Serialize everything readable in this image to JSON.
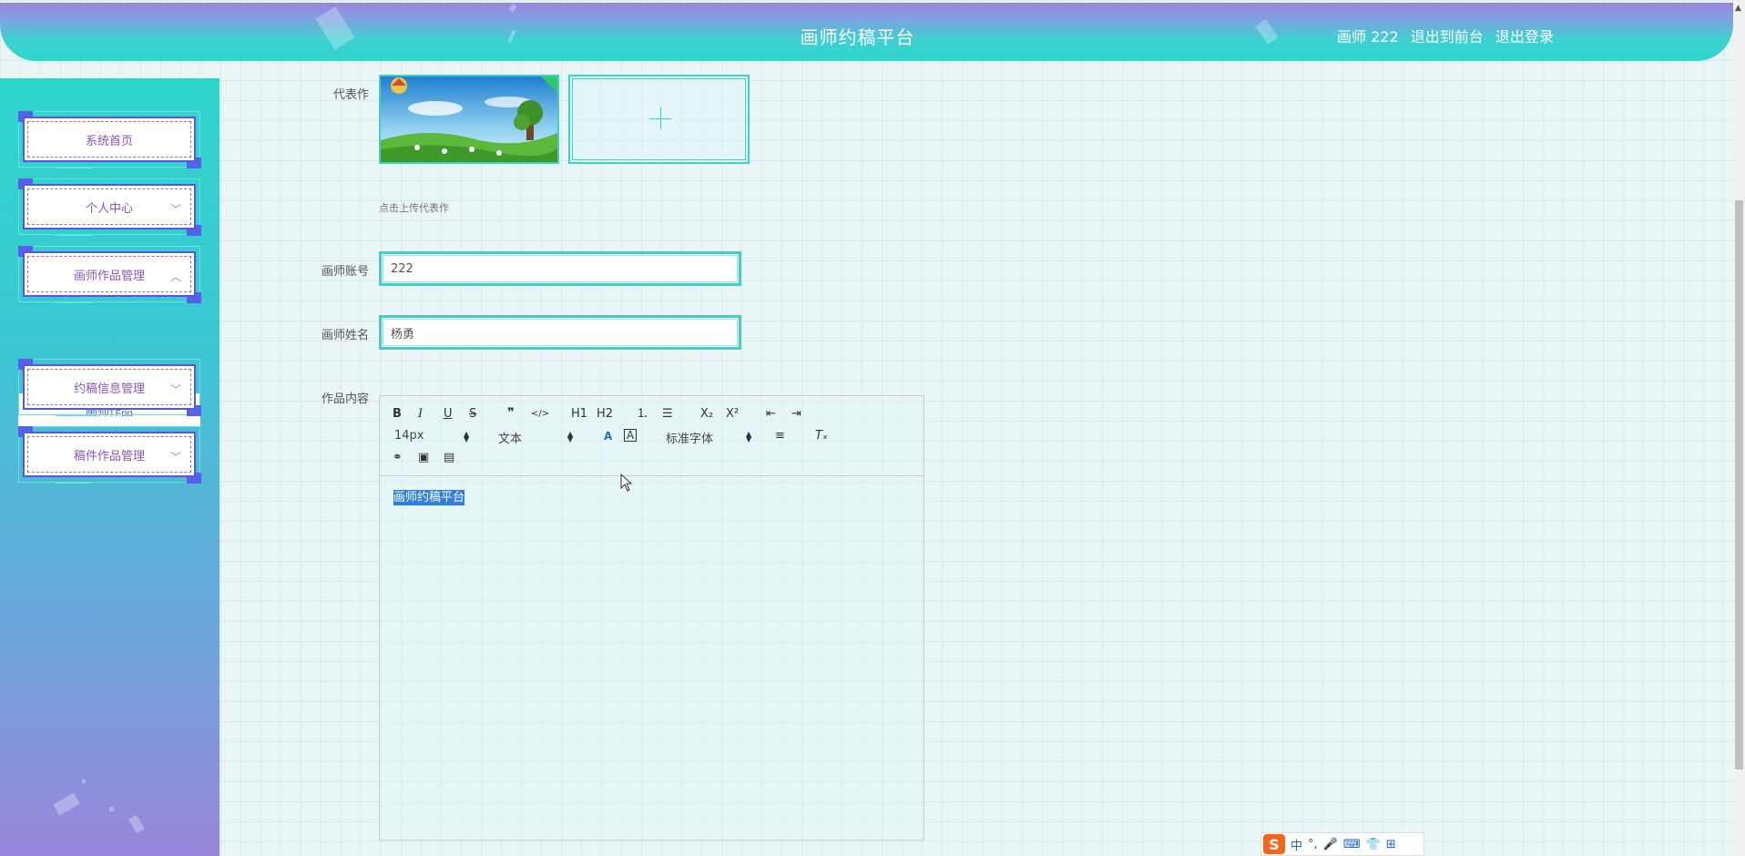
{
  "header": {
    "title": "画师约稿平台",
    "user_label": "画师 222",
    "front_link": "退出到前台",
    "logout_link": "退出登录"
  },
  "sidebar": {
    "items": [
      {
        "label": "系统首页",
        "chevron": ""
      },
      {
        "label": "个人中心",
        "chevron": "﹀"
      },
      {
        "label": "画师作品管理",
        "chevron": "︿"
      },
      {
        "label": "约稿信息管理",
        "chevron": "﹀"
      },
      {
        "label": "稿件作品管理",
        "chevron": "﹀"
      }
    ],
    "submenu": {
      "label": "画师作品"
    }
  },
  "form": {
    "works_label": "代表作",
    "upload_hint": "点击上传代表作",
    "account_label": "画师账号",
    "account_value": "222",
    "name_label": "画师姓名",
    "name_value": "杨勇",
    "content_label": "作品内容"
  },
  "editor": {
    "toolbar": {
      "bold": "B",
      "italic": "I",
      "underline": "U",
      "strike": "S",
      "quote": "❞",
      "code": "</>",
      "h1": "H1",
      "h2": "H2",
      "ordered": "⒈",
      "bullet": "☰",
      "sub": "X₂",
      "sup": "X²",
      "outdent": "⇤",
      "indent": "⇥",
      "size": "14px",
      "header": "文本",
      "font": "标准字体",
      "align": "≡",
      "clean": "Tₓ",
      "link": "⚭",
      "image": "▣",
      "video": "▤"
    },
    "content": "画师约稿平台"
  },
  "ime": {
    "logo": "S",
    "mode": "中",
    "punct": "°,",
    "mic": "🎤",
    "kbd": "⌨",
    "skin": "👕",
    "grid": "⊞"
  },
  "colors": {
    "accent": "#3fd0c6",
    "brand_purple": "#9a86dc",
    "menu_text": "#8a55c8",
    "selection": "#2f7fe0"
  }
}
